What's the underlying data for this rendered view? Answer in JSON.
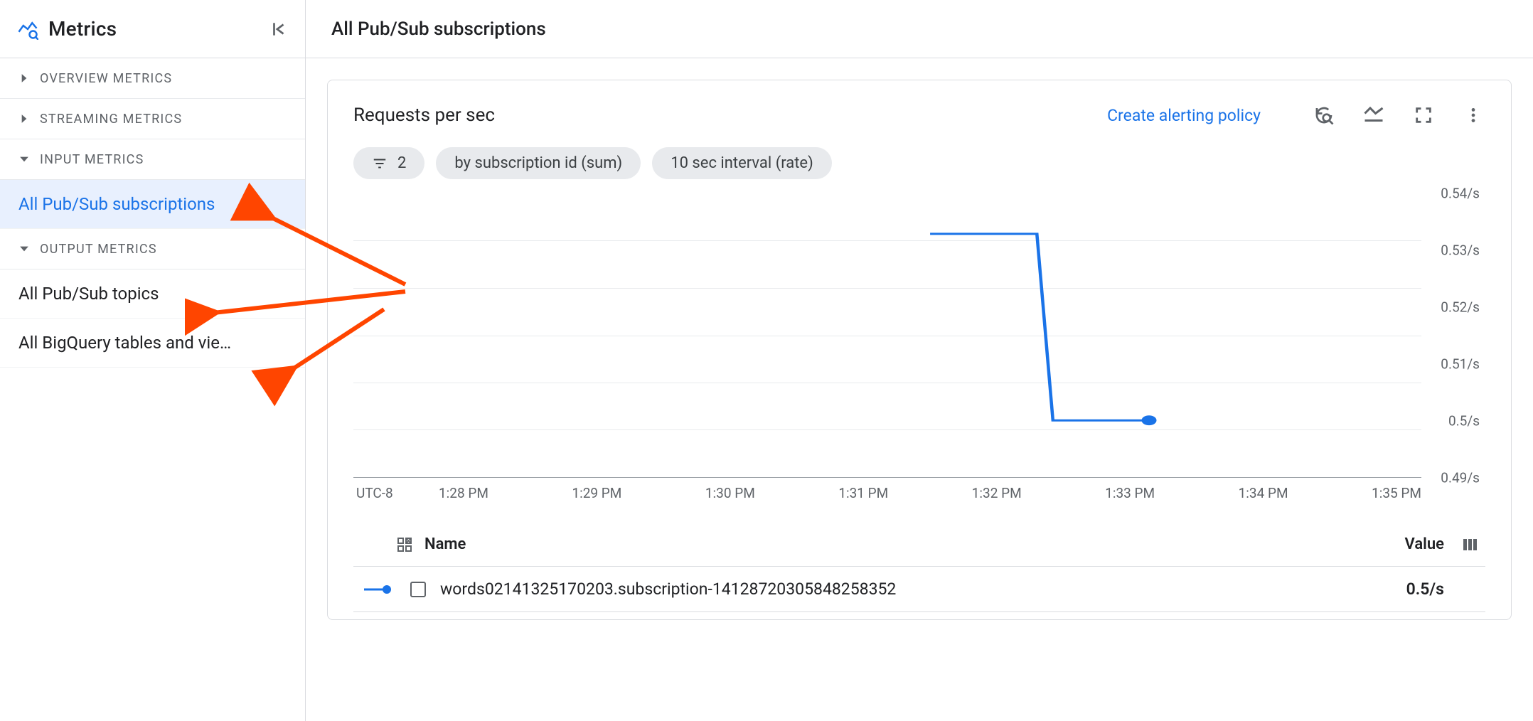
{
  "sidebar": {
    "title": "Metrics",
    "groups": [
      {
        "id": "overview",
        "label": "OVERVIEW METRICS",
        "expanded": false
      },
      {
        "id": "streaming",
        "label": "STREAMING METRICS",
        "expanded": false
      },
      {
        "id": "input",
        "label": "INPUT METRICS",
        "expanded": true,
        "items": [
          {
            "id": "pubsub-subs",
            "label": "All Pub/Sub subscriptions",
            "selected": true
          }
        ]
      },
      {
        "id": "output",
        "label": "OUTPUT METRICS",
        "expanded": true,
        "items": [
          {
            "id": "pubsub-topics",
            "label": "All Pub/Sub topics",
            "selected": false
          },
          {
            "id": "bq-tables",
            "label": "All BigQuery tables and vie…",
            "selected": false
          }
        ]
      }
    ]
  },
  "header": {
    "title": "All Pub/Sub subscriptions"
  },
  "card": {
    "title": "Requests per sec",
    "link": "Create alerting policy",
    "chips": {
      "filter_count": "2",
      "grouping": "by subscription id (sum)",
      "interval": "10 sec interval (rate)"
    }
  },
  "chart_data": {
    "type": "line",
    "title": "Requests per sec",
    "xlabel": "UTC-8",
    "ylabel": "",
    "ylim": [
      0.49,
      0.54
    ],
    "y_ticks": [
      "0.54/s",
      "0.53/s",
      "0.52/s",
      "0.51/s",
      "0.5/s",
      "0.49/s"
    ],
    "x_ticks": [
      "1:28 PM",
      "1:29 PM",
      "1:30 PM",
      "1:31 PM",
      "1:32 PM",
      "1:33 PM",
      "1:34 PM",
      "1:35 PM"
    ],
    "timezone": "UTC-8",
    "series": [
      {
        "name": "words02141325170203.subscription-14128720305848258352",
        "color": "#1a73e8",
        "points": [
          {
            "x": "1:31:30 PM",
            "y": 0.533
          },
          {
            "x": "1:32:15 PM",
            "y": 0.533
          },
          {
            "x": "1:32:25 PM",
            "y": 0.5
          },
          {
            "x": "1:33:10 PM",
            "y": 0.5
          }
        ]
      }
    ]
  },
  "table": {
    "headers": {
      "name": "Name",
      "value": "Value"
    },
    "rows": [
      {
        "name": "words02141325170203.subscription-14128720305848258352",
        "value": "0.5/s",
        "color": "#1a73e8"
      }
    ]
  }
}
